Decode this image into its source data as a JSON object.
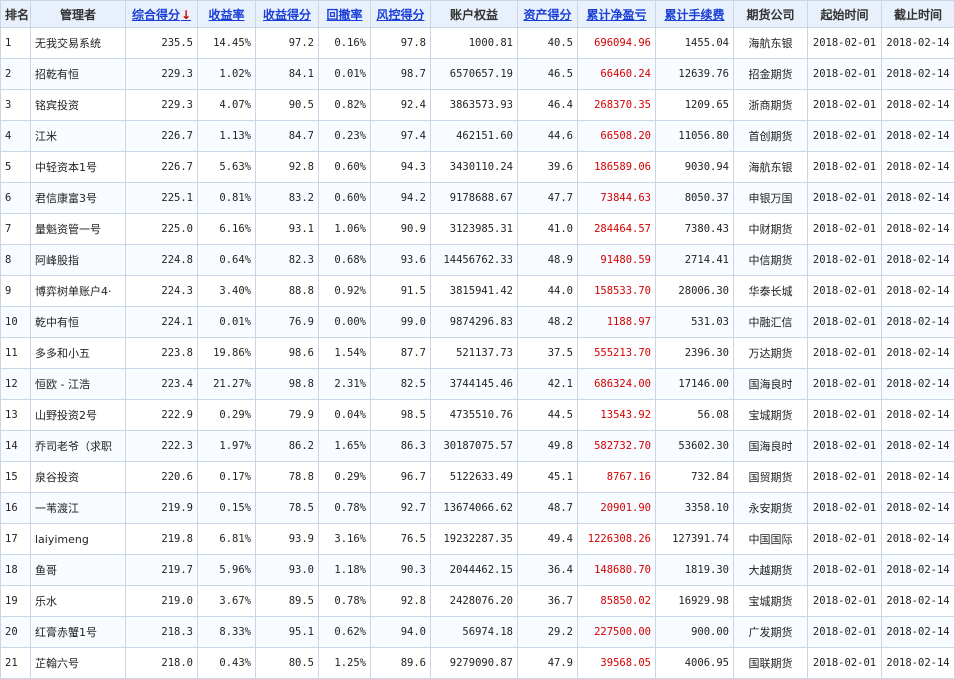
{
  "table": {
    "headers": [
      {
        "label": "排名",
        "sortable": false
      },
      {
        "label": "管理者",
        "sortable": false
      },
      {
        "label": "综合得分",
        "sortable": true,
        "sort_indicator": "↓"
      },
      {
        "label": "收益率",
        "sortable": true
      },
      {
        "label": "收益得分",
        "sortable": true
      },
      {
        "label": "回撤率",
        "sortable": true
      },
      {
        "label": "风控得分",
        "sortable": true
      },
      {
        "label": "账户权益",
        "sortable": false
      },
      {
        "label": "资产得分",
        "sortable": true
      },
      {
        "label": "累计净盈亏",
        "sortable": true
      },
      {
        "label": "累计手续费",
        "sortable": true
      },
      {
        "label": "期货公司",
        "sortable": false
      },
      {
        "label": "起始时间",
        "sortable": false
      },
      {
        "label": "截止时间",
        "sortable": false
      }
    ],
    "rows": [
      {
        "rank": "1",
        "manager": "无我交易系统",
        "score": "235.5",
        "return_rate": "14.45%",
        "return_score": "97.2",
        "drawdown": "0.16%",
        "risk_score": "97.8",
        "equity": "1000.81",
        "asset_score": "40.5",
        "net_pnl": "696094.96",
        "fees": "1455.04",
        "broker": "海航东银",
        "start": "2018-02-01",
        "end": "2018-02-14"
      },
      {
        "rank": "2",
        "manager": "招乾有恒",
        "score": "229.3",
        "return_rate": "1.02%",
        "return_score": "84.1",
        "drawdown": "0.01%",
        "risk_score": "98.7",
        "equity": "6570657.19",
        "asset_score": "46.5",
        "net_pnl": "66460.24",
        "fees": "12639.76",
        "broker": "招金期货",
        "start": "2018-02-01",
        "end": "2018-02-14"
      },
      {
        "rank": "3",
        "manager": "铭宾投资",
        "score": "229.3",
        "return_rate": "4.07%",
        "return_score": "90.5",
        "drawdown": "0.82%",
        "risk_score": "92.4",
        "equity": "3863573.93",
        "asset_score": "46.4",
        "net_pnl": "268370.35",
        "fees": "1209.65",
        "broker": "浙商期货",
        "start": "2018-02-01",
        "end": "2018-02-14"
      },
      {
        "rank": "4",
        "manager": "江米",
        "score": "226.7",
        "return_rate": "1.13%",
        "return_score": "84.7",
        "drawdown": "0.23%",
        "risk_score": "97.4",
        "equity": "462151.60",
        "asset_score": "44.6",
        "net_pnl": "66508.20",
        "fees": "11056.80",
        "broker": "首创期货",
        "start": "2018-02-01",
        "end": "2018-02-14"
      },
      {
        "rank": "5",
        "manager": "中轻资本1号",
        "score": "226.7",
        "return_rate": "5.63%",
        "return_score": "92.8",
        "drawdown": "0.60%",
        "risk_score": "94.3",
        "equity": "3430110.24",
        "asset_score": "39.6",
        "net_pnl": "186589.06",
        "fees": "9030.94",
        "broker": "海航东银",
        "start": "2018-02-01",
        "end": "2018-02-14"
      },
      {
        "rank": "6",
        "manager": "君信康富3号",
        "score": "225.1",
        "return_rate": "0.81%",
        "return_score": "83.2",
        "drawdown": "0.60%",
        "risk_score": "94.2",
        "equity": "9178688.67",
        "asset_score": "47.7",
        "net_pnl": "73844.63",
        "fees": "8050.37",
        "broker": "申银万国",
        "start": "2018-02-01",
        "end": "2018-02-14"
      },
      {
        "rank": "7",
        "manager": "量魁资管一号",
        "score": "225.0",
        "return_rate": "6.16%",
        "return_score": "93.1",
        "drawdown": "1.06%",
        "risk_score": "90.9",
        "equity": "3123985.31",
        "asset_score": "41.0",
        "net_pnl": "284464.57",
        "fees": "7380.43",
        "broker": "中财期货",
        "start": "2018-02-01",
        "end": "2018-02-14"
      },
      {
        "rank": "8",
        "manager": "阿峰股指",
        "score": "224.8",
        "return_rate": "0.64%",
        "return_score": "82.3",
        "drawdown": "0.68%",
        "risk_score": "93.6",
        "equity": "14456762.33",
        "asset_score": "48.9",
        "net_pnl": "91480.59",
        "fees": "2714.41",
        "broker": "中信期货",
        "start": "2018-02-01",
        "end": "2018-02-14"
      },
      {
        "rank": "9",
        "manager": "博弈树单账户4·",
        "score": "224.3",
        "return_rate": "3.40%",
        "return_score": "88.8",
        "drawdown": "0.92%",
        "risk_score": "91.5",
        "equity": "3815941.42",
        "asset_score": "44.0",
        "net_pnl": "158533.70",
        "fees": "28006.30",
        "broker": "华泰长城",
        "start": "2018-02-01",
        "end": "2018-02-14"
      },
      {
        "rank": "10",
        "manager": "乾中有恒",
        "score": "224.1",
        "return_rate": "0.01%",
        "return_score": "76.9",
        "drawdown": "0.00%",
        "risk_score": "99.0",
        "equity": "9874296.83",
        "asset_score": "48.2",
        "net_pnl": "1188.97",
        "fees": "531.03",
        "broker": "中融汇信",
        "start": "2018-02-01",
        "end": "2018-02-14"
      },
      {
        "rank": "11",
        "manager": "多多和小五",
        "score": "223.8",
        "return_rate": "19.86%",
        "return_score": "98.6",
        "drawdown": "1.54%",
        "risk_score": "87.7",
        "equity": "521137.73",
        "asset_score": "37.5",
        "net_pnl": "555213.70",
        "fees": "2396.30",
        "broker": "万达期货",
        "start": "2018-02-01",
        "end": "2018-02-14"
      },
      {
        "rank": "12",
        "manager": "恒欧 - 江浩",
        "score": "223.4",
        "return_rate": "21.27%",
        "return_score": "98.8",
        "drawdown": "2.31%",
        "risk_score": "82.5",
        "equity": "3744145.46",
        "asset_score": "42.1",
        "net_pnl": "686324.00",
        "fees": "17146.00",
        "broker": "国海良时",
        "start": "2018-02-01",
        "end": "2018-02-14"
      },
      {
        "rank": "13",
        "manager": "山野投资2号",
        "score": "222.9",
        "return_rate": "0.29%",
        "return_score": "79.9",
        "drawdown": "0.04%",
        "risk_score": "98.5",
        "equity": "4735510.76",
        "asset_score": "44.5",
        "net_pnl": "13543.92",
        "fees": "56.08",
        "broker": "宝城期货",
        "start": "2018-02-01",
        "end": "2018-02-14"
      },
      {
        "rank": "14",
        "manager": "乔司老爷（求职",
        "score": "222.3",
        "return_rate": "1.97%",
        "return_score": "86.2",
        "drawdown": "1.65%",
        "risk_score": "86.3",
        "equity": "30187075.57",
        "asset_score": "49.8",
        "net_pnl": "582732.70",
        "fees": "53602.30",
        "broker": "国海良时",
        "start": "2018-02-01",
        "end": "2018-02-14"
      },
      {
        "rank": "15",
        "manager": "泉谷投资",
        "score": "220.6",
        "return_rate": "0.17%",
        "return_score": "78.8",
        "drawdown": "0.29%",
        "risk_score": "96.7",
        "equity": "5122633.49",
        "asset_score": "45.1",
        "net_pnl": "8767.16",
        "fees": "732.84",
        "broker": "国贸期货",
        "start": "2018-02-01",
        "end": "2018-02-14"
      },
      {
        "rank": "16",
        "manager": "一苇渡江",
        "score": "219.9",
        "return_rate": "0.15%",
        "return_score": "78.5",
        "drawdown": "0.78%",
        "risk_score": "92.7",
        "equity": "13674066.62",
        "asset_score": "48.7",
        "net_pnl": "20901.90",
        "fees": "3358.10",
        "broker": "永安期货",
        "start": "2018-02-01",
        "end": "2018-02-14"
      },
      {
        "rank": "17",
        "manager": "laiyimeng",
        "score": "219.8",
        "return_rate": "6.81%",
        "return_score": "93.9",
        "drawdown": "3.16%",
        "risk_score": "76.5",
        "equity": "19232287.35",
        "asset_score": "49.4",
        "net_pnl": "1226308.26",
        "fees": "127391.74",
        "broker": "中国国际",
        "start": "2018-02-01",
        "end": "2018-02-14"
      },
      {
        "rank": "18",
        "manager": "鱼哥",
        "score": "219.7",
        "return_rate": "5.96%",
        "return_score": "93.0",
        "drawdown": "1.18%",
        "risk_score": "90.3",
        "equity": "2044462.15",
        "asset_score": "36.4",
        "net_pnl": "148680.70",
        "fees": "1819.30",
        "broker": "大越期货",
        "start": "2018-02-01",
        "end": "2018-02-14"
      },
      {
        "rank": "19",
        "manager": "乐水",
        "score": "219.0",
        "return_rate": "3.67%",
        "return_score": "89.5",
        "drawdown": "0.78%",
        "risk_score": "92.8",
        "equity": "2428076.20",
        "asset_score": "36.7",
        "net_pnl": "85850.02",
        "fees": "16929.98",
        "broker": "宝城期货",
        "start": "2018-02-01",
        "end": "2018-02-14"
      },
      {
        "rank": "20",
        "manager": "红膏赤蟹1号",
        "score": "218.3",
        "return_rate": "8.33%",
        "return_score": "95.1",
        "drawdown": "0.62%",
        "risk_score": "94.0",
        "equity": "56974.18",
        "asset_score": "29.2",
        "net_pnl": "227500.00",
        "fees": "900.00",
        "broker": "广发期货",
        "start": "2018-02-01",
        "end": "2018-02-14"
      },
      {
        "rank": "21",
        "manager": "芷翰六号",
        "score": "218.0",
        "return_rate": "0.43%",
        "return_score": "80.5",
        "drawdown": "1.25%",
        "risk_score": "89.6",
        "equity": "9279090.87",
        "asset_score": "47.9",
        "net_pnl": "39568.05",
        "fees": "4006.95",
        "broker": "国联期货",
        "start": "2018-02-01",
        "end": "2018-02-14"
      }
    ]
  },
  "colors": {
    "header_bg": "#e8f0fb",
    "link_blue": "#1a3fd6",
    "pnl_red": "#d40000",
    "border": "#c8d7e8"
  }
}
